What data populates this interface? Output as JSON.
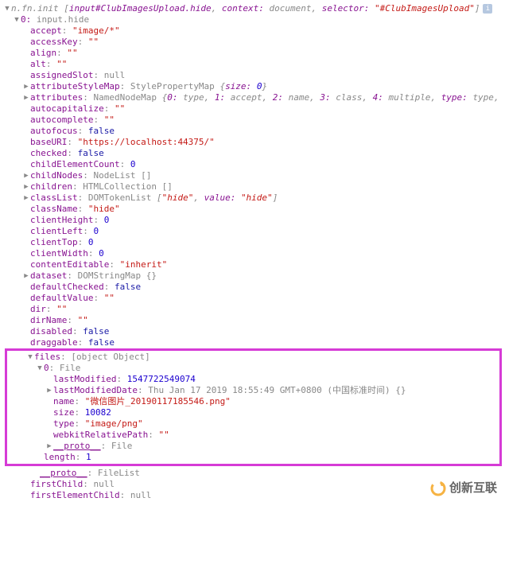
{
  "header": {
    "prefix": "n.fn.init ",
    "bracket_open": "[",
    "element": "input#ClubImagesUpload.hide",
    "context_key": "context: ",
    "context_val": "document",
    "selector_key": "selector: ",
    "selector_val": "\"#ClubImagesUpload\"",
    "bracket_close": "]"
  },
  "item0": {
    "key": "0: ",
    "val": "input.hide"
  },
  "props": {
    "accept": {
      "k": "accept",
      "v": "\"image/*\""
    },
    "accessKey": {
      "k": "accessKey",
      "v": "\"\""
    },
    "align": {
      "k": "align",
      "v": "\"\""
    },
    "alt": {
      "k": "alt",
      "v": "\"\""
    },
    "assignedSlot": {
      "k": "assignedSlot",
      "v": "null"
    },
    "attributeStyleMap": {
      "k": "attributeStyleMap",
      "v": "StylePropertyMap ",
      "extra_key": "size: ",
      "extra_val": "0"
    },
    "attributes": {
      "k": "attributes",
      "v": "NamedNodeMap ",
      "parts": [
        {
          "k": "0: ",
          "v": "type"
        },
        {
          "k": "1: ",
          "v": "accept"
        },
        {
          "k": "2: ",
          "v": "name"
        },
        {
          "k": "3: ",
          "v": "class"
        },
        {
          "k": "4: ",
          "v": "multiple"
        },
        {
          "k": "type: ",
          "v": "type"
        }
      ]
    },
    "autocapitalize": {
      "k": "autocapitalize",
      "v": "\"\""
    },
    "autocomplete": {
      "k": "autocomplete",
      "v": "\"\""
    },
    "autofocus": {
      "k": "autofocus",
      "v": "false"
    },
    "baseURI": {
      "k": "baseURI",
      "v": "\"https://localhost:44375/\""
    },
    "checked": {
      "k": "checked",
      "v": "false"
    },
    "childElementCount": {
      "k": "childElementCount",
      "v": "0"
    },
    "childNodes": {
      "k": "childNodes",
      "v": "NodeList []"
    },
    "children": {
      "k": "children",
      "v": "HTMLCollection []"
    },
    "classList": {
      "k": "classList",
      "v": "DOMTokenList ",
      "arr_open": "[",
      "arr_item": "\"hide\"",
      "val_key": "value: ",
      "val_val": "\"hide\"",
      "arr_close": "]"
    },
    "className": {
      "k": "className",
      "v": "\"hide\""
    },
    "clientHeight": {
      "k": "clientHeight",
      "v": "0"
    },
    "clientLeft": {
      "k": "clientLeft",
      "v": "0"
    },
    "clientTop": {
      "k": "clientTop",
      "v": "0"
    },
    "clientWidth": {
      "k": "clientWidth",
      "v": "0"
    },
    "contentEditable": {
      "k": "contentEditable",
      "v": "\"inherit\""
    },
    "dataset": {
      "k": "dataset",
      "v": "DOMStringMap {}"
    },
    "defaultChecked": {
      "k": "defaultChecked",
      "v": "false"
    },
    "defaultValue": {
      "k": "defaultValue",
      "v": "\"\""
    },
    "dir": {
      "k": "dir",
      "v": "\"\""
    },
    "dirName": {
      "k": "dirName",
      "v": "\"\""
    },
    "disabled": {
      "k": "disabled",
      "v": "false"
    },
    "draggable": {
      "k": "draggable",
      "v": "false"
    }
  },
  "files": {
    "key": "files",
    "type": {
      "k": "type",
      "v": "\"image/png\""
    },
    "item0": {
      "k": "0",
      "v": "File"
    },
    "lastModified": {
      "k": "lastModified",
      "v": "1547722549074"
    },
    "lastModifiedDate": {
      "k": "lastModifiedDate",
      "v": "Thu Jan 17 2019 18:55:49 GMT+0800 (中国标准时间) {}"
    },
    "name": {
      "k": "name",
      "v": "\"微信图片_20190117185546.png\""
    },
    "size": {
      "k": "size",
      "v": "10082"
    },
    "webkitRelativePath": {
      "k": "webkitRelativePath",
      "v": "\"\""
    },
    "proto": {
      "k": "__proto__",
      "v": "File"
    },
    "length": {
      "k": "length",
      "v": "1"
    }
  },
  "tail": {
    "proto": {
      "k": "__proto__",
      "v": "FileList"
    },
    "firstChild": {
      "k": "firstChild",
      "v": "null"
    },
    "firstElementChild": {
      "k": "firstElementChild",
      "v": "null"
    }
  },
  "watermark": "创新互联"
}
